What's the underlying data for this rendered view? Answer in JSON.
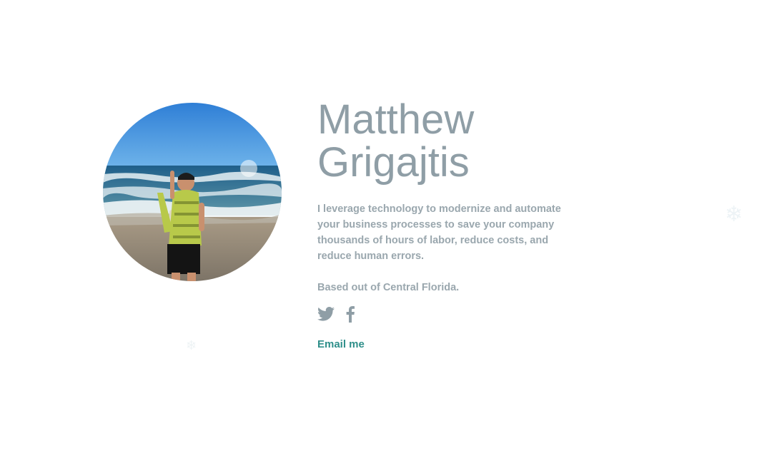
{
  "profile": {
    "first_name": "Matthew",
    "last_name": "Grigajtis",
    "bio": "I leverage technology to modernize and automate your business processes to save your company thousands of hours of labor, reduce costs, and reduce human errors.",
    "location": "Based out of Central Florida."
  },
  "social": {
    "twitter_icon": "twitter-icon",
    "facebook_icon": "facebook-icon"
  },
  "contact": {
    "email_label": "Email me"
  },
  "colors": {
    "name": "#8f9ea6",
    "text": "#9aa7ae",
    "link": "#2f8f8a",
    "icon": "#8f9ea6"
  }
}
